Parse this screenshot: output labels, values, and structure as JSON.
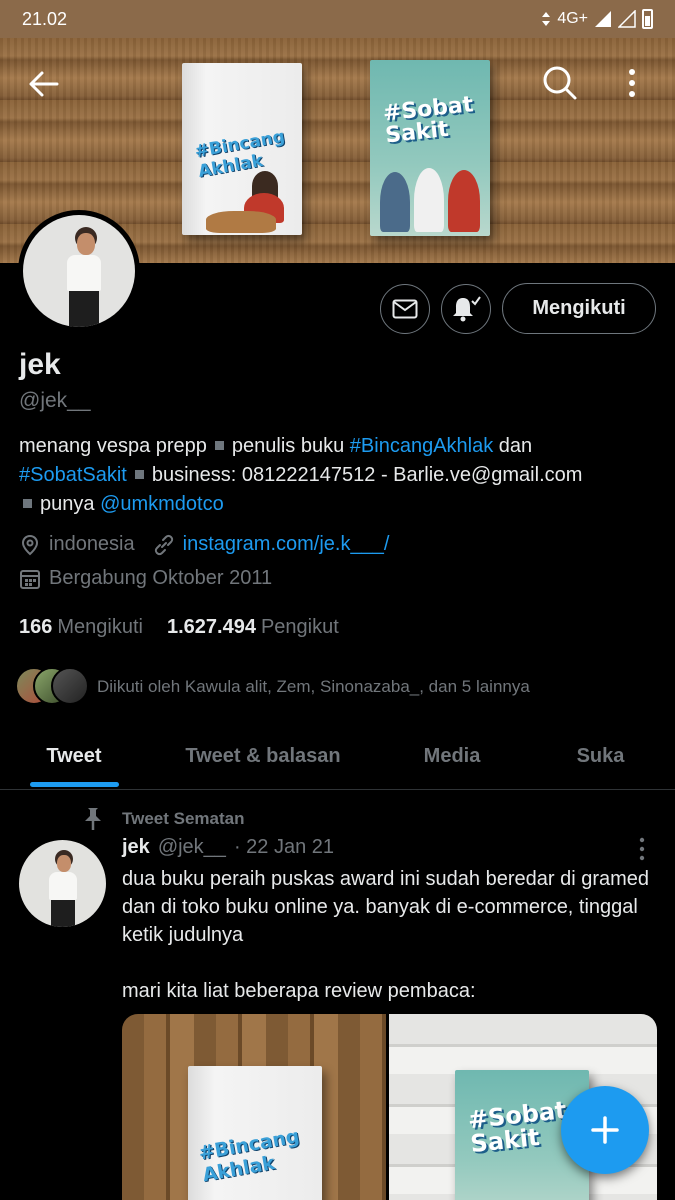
{
  "status_bar": {
    "time": "21.02",
    "network": "4G+"
  },
  "profile": {
    "name": "jek",
    "handle": "@jek__",
    "follow_button": "Mengikuti",
    "bio": {
      "part1": "menang vespa prepp",
      "part2": "penulis buku",
      "tag1": "#BincangAkhlak",
      "and": "dan",
      "tag2": "#SobatSakit",
      "part3": "business: 081222147512 - Barlie.ve@gmail.com",
      "part4": "punya",
      "mention": "@umkmdotco"
    },
    "location": "indonesia",
    "website": "instagram.com/je.k___/",
    "joined": "Bergabung Oktober 2011",
    "following_count": "166",
    "following_label": "Mengikuti",
    "followers_count": "1.627.494",
    "followers_label": "Pengikut",
    "followed_by": "Diikuti oleh Kawula alit, Zem, Sinonazaba_, dan 5 lainnya"
  },
  "banner_books": {
    "book1_title": "#Bincang Akhlak",
    "book2_title": "#Sobat Sakit"
  },
  "tabs": [
    {
      "label": "Tweet",
      "active": true
    },
    {
      "label": "Tweet & balasan",
      "active": false
    },
    {
      "label": "Media",
      "active": false
    },
    {
      "label": "Suka",
      "active": false
    }
  ],
  "tweet": {
    "pinned_label": "Tweet Sematan",
    "author_name": "jek",
    "author_handle": "@jek__",
    "date": "· 22 Jan 21",
    "text": "dua buku peraih puskas award ini sudah beredar di gramed dan di toko buku online ya. banyak di e-commerce, tinggal ketik judulnya\n\nmari kita liat beberapa review pembaca:",
    "media_titles": [
      "#Bincang Akhlak",
      "#Sobat Sakit"
    ]
  },
  "icons": {
    "back": "back-arrow-icon",
    "search": "search-icon",
    "more": "more-vertical-icon",
    "mail": "mail-icon",
    "bell": "notification-bell-icon",
    "location": "location-icon",
    "link": "link-icon",
    "calendar": "calendar-icon",
    "pin": "pin-icon",
    "compose": "plus-icon"
  },
  "colors": {
    "accent": "#1d9bf0",
    "text": "#e7e9ea",
    "muted": "#71767b",
    "background": "#000000"
  }
}
